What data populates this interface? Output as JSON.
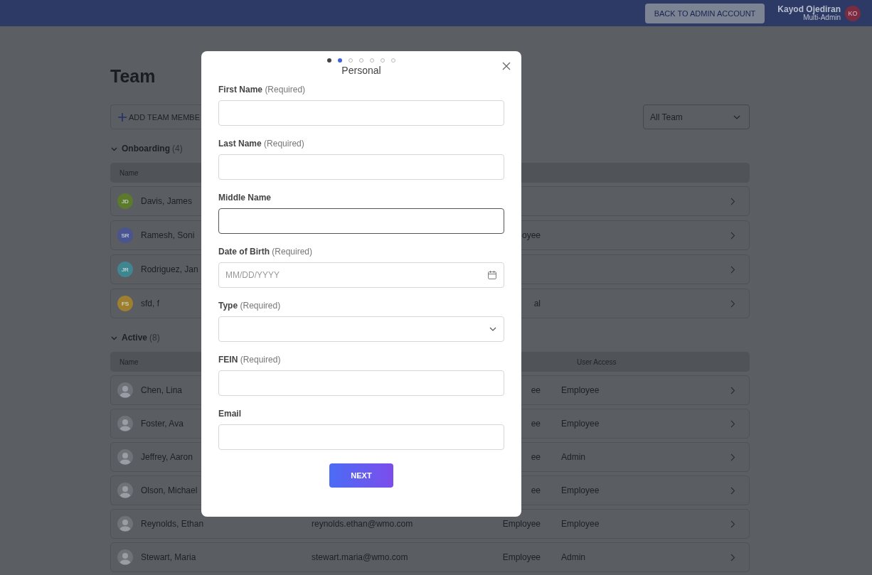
{
  "top_bar": {
    "back_button": "BACK TO ADMIN ACCOUNT",
    "user": {
      "name": "Kayod Ojediran",
      "role": "Multi-Admin",
      "initials": "KO"
    }
  },
  "page": {
    "title": "Team",
    "add_button": "ADD TEAM MEMBE",
    "filter": {
      "value": "All Team"
    },
    "sections": [
      {
        "title": "Onboarding",
        "count": "(4)",
        "expanded": true,
        "columns": [
          "Name",
          "",
          ""
        ],
        "rows": [
          {
            "avatar": {
              "kind": "initials",
              "initials": "JD",
              "color": "#5b7a2c"
            },
            "name": "Davis, James",
            "column_3": "",
            "column_4": ""
          },
          {
            "avatar": {
              "kind": "initials",
              "initials": "SR",
              "color": "#4a5590"
            },
            "name": "Ramesh, Soni",
            "column_3": "oyee",
            "column_4": ""
          },
          {
            "avatar": {
              "kind": "initials",
              "initials": "JR",
              "color": "#3f8690"
            },
            "name": "Rodriguez, Jan",
            "column_3": "",
            "column_4": ""
          },
          {
            "avatar": {
              "kind": "initials",
              "initials": "FS",
              "color": "#9c8030"
            },
            "name": "sfd, f",
            "column_3": "al",
            "column_4": ""
          }
        ]
      },
      {
        "title": "Active",
        "count": "(8)",
        "expanded": true,
        "columns": [
          "Name",
          "",
          "User Access"
        ],
        "rows": [
          {
            "avatar": {
              "kind": "photo"
            },
            "name": "Chen, Lina",
            "column_3": "ee",
            "column_4": "Employee"
          },
          {
            "avatar": {
              "kind": "photo"
            },
            "name": "Foster, Ava",
            "column_3": "ee",
            "column_4": "Employee"
          },
          {
            "avatar": {
              "kind": "photo"
            },
            "name": "Jeffrey, Aaron",
            "column_3": "ee",
            "column_4": "Admin"
          },
          {
            "avatar": {
              "kind": "photo"
            },
            "name": "Olson, Michael",
            "column_3": "ee",
            "column_4": "Employee"
          },
          {
            "avatar": {
              "kind": "photo"
            },
            "name": "Reynolds, Ethan",
            "email": "reynolds.ethan@wmo.com",
            "column_3": "Employee",
            "column_4": "Employee"
          },
          {
            "avatar": {
              "kind": "photo"
            },
            "name": "Stewart, Maria",
            "email": "stewart.maria@wmo.com",
            "column_3": "Employee",
            "column_4": "Admin"
          }
        ]
      }
    ]
  },
  "dialog": {
    "steps": [
      {
        "completed": true,
        "selected": false
      },
      {
        "completed": false,
        "selected": true
      },
      {
        "completed": false,
        "selected": false
      },
      {
        "completed": false,
        "selected": false
      },
      {
        "completed": false,
        "selected": false
      },
      {
        "completed": false,
        "selected": false
      },
      {
        "completed": false,
        "selected": false
      }
    ],
    "title": "Personal",
    "fields": [
      {
        "kind": "text",
        "label": "First Name",
        "note": "(Required)",
        "focused": false
      },
      {
        "kind": "text",
        "label": "Last Name",
        "note": "(Required)",
        "focused": false
      },
      {
        "kind": "text",
        "label": "Middle Name",
        "focused": true
      },
      {
        "kind": "date",
        "label": "Date of Birth",
        "note": "(Required)",
        "placeholder": "MM/DD/YYYY",
        "focused": false
      },
      {
        "kind": "select",
        "label": "Type",
        "note": "(Required)",
        "focused": false
      },
      {
        "kind": "text",
        "label": "FEIN",
        "note": "(Required)",
        "focused": false
      },
      {
        "kind": "text",
        "label": "Email",
        "focused": false
      }
    ],
    "next_button": "NEXT"
  }
}
